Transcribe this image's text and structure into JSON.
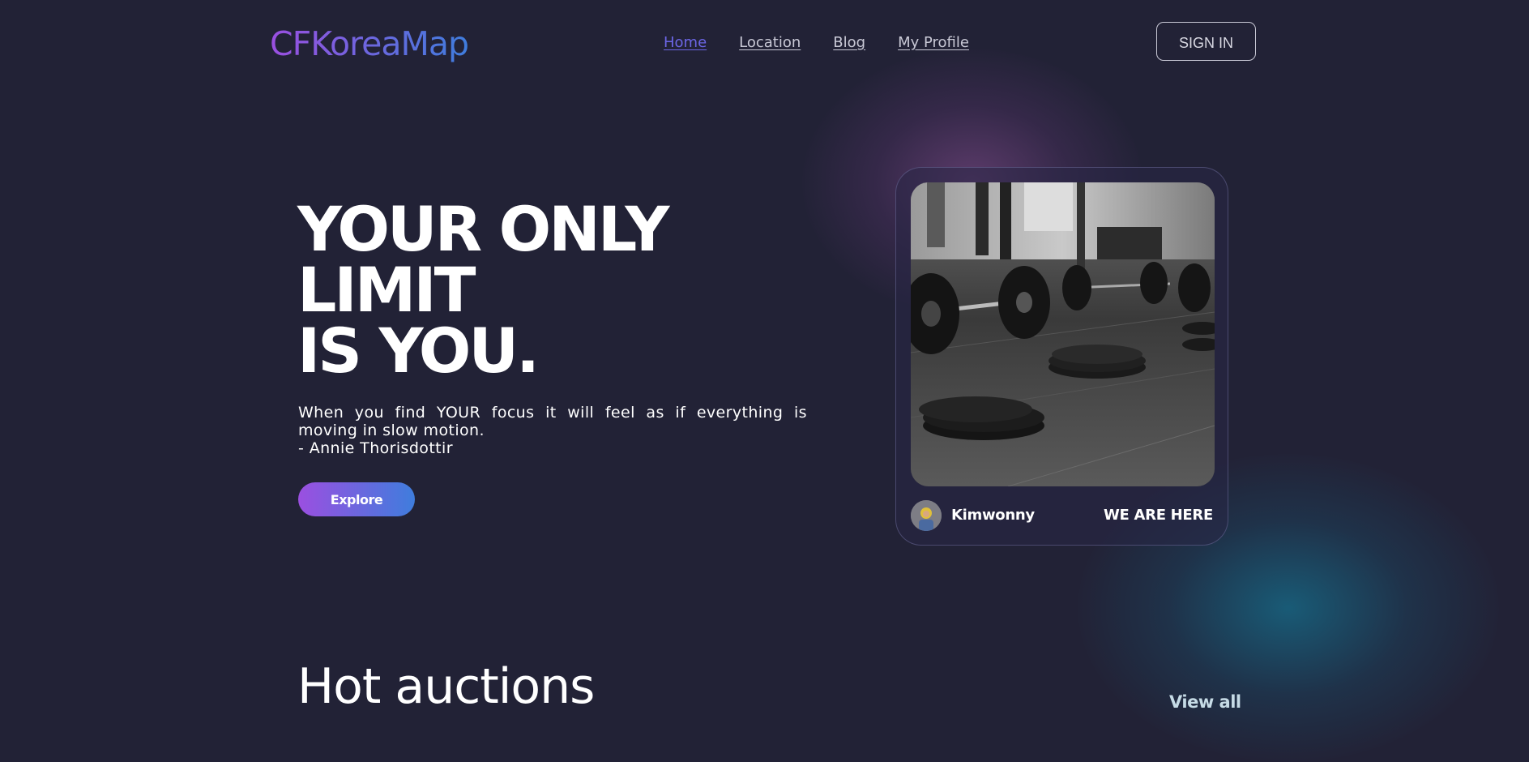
{
  "header": {
    "logo": "CFKoreaMap",
    "nav": [
      {
        "label": "Home",
        "active": true
      },
      {
        "label": "Location",
        "active": false
      },
      {
        "label": "Blog",
        "active": false
      },
      {
        "label": "My Profile",
        "active": false
      }
    ],
    "signin_label": "SIGN IN"
  },
  "hero": {
    "headline_lines": [
      "YOUR ONLY",
      "LIMIT",
      "IS YOU."
    ],
    "quote_lines": [
      "When you find YOUR focus it will feel as if everything is moving in slow motion.",
      "- Annie Thorisdottir"
    ],
    "cta_label": "Explore"
  },
  "card": {
    "image_icon": "barbell-photo",
    "avatar_icon": "avatar",
    "username": "Kimwonny",
    "tag": "WE ARE HERE"
  },
  "section": {
    "title": "Hot auctions",
    "view_all_label": "View all"
  },
  "colors": {
    "background": "#222236",
    "gradient_start": "#9b4fe0",
    "gradient_end": "#3f7ddd",
    "nav_active": "#6c66e6",
    "nav_text": "#c9c9d6"
  }
}
